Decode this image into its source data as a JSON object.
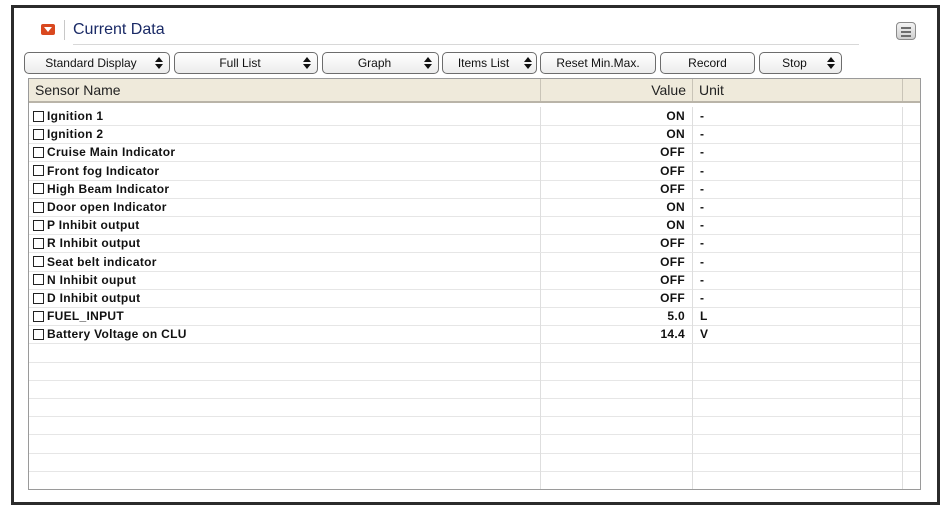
{
  "panel": {
    "title": "Current Data",
    "collapse_icon": "collapse-arrow-icon",
    "menu_icon": "panel-menu-icon"
  },
  "toolbar": {
    "buttons": [
      {
        "label": "Standard Display",
        "dropdown": true
      },
      {
        "label": "Full List",
        "dropdown": true
      },
      {
        "label": "Graph",
        "dropdown": true
      },
      {
        "label": "Items List",
        "dropdown": true
      },
      {
        "label": "Reset Min.Max.",
        "dropdown": false
      },
      {
        "label": "Record",
        "dropdown": false
      },
      {
        "label": "Stop",
        "dropdown": true
      }
    ]
  },
  "table": {
    "headers": {
      "name": "Sensor Name",
      "value": "Value",
      "unit": "Unit"
    },
    "rows": [
      {
        "name": "Ignition 1",
        "value": "ON",
        "unit": "-"
      },
      {
        "name": "Ignition 2",
        "value": "ON",
        "unit": "-"
      },
      {
        "name": "Cruise Main Indicator",
        "value": "OFF",
        "unit": "-"
      },
      {
        "name": "Front fog Indicator",
        "value": "OFF",
        "unit": "-"
      },
      {
        "name": "High Beam Indicator",
        "value": "OFF",
        "unit": "-"
      },
      {
        "name": "Door open Indicator",
        "value": "ON",
        "unit": "-"
      },
      {
        "name": "P Inhibit output",
        "value": "ON",
        "unit": "-"
      },
      {
        "name": "R Inhibit output",
        "value": "OFF",
        "unit": "-"
      },
      {
        "name": "Seat belt indicator",
        "value": "OFF",
        "unit": "-"
      },
      {
        "name": "N Inhibit ouput",
        "value": "OFF",
        "unit": "-"
      },
      {
        "name": "D Inhibit output",
        "value": "OFF",
        "unit": "-"
      },
      {
        "name": "FUEL_INPUT",
        "value": "5.0",
        "unit": "L"
      },
      {
        "name": "Battery Voltage on CLU",
        "value": "14.4",
        "unit": "V"
      }
    ],
    "empty_rows": 8
  },
  "colors": {
    "title_text": "#1a2a66",
    "collapse_icon": "#d9481f",
    "header_bg": "#efeadb"
  }
}
